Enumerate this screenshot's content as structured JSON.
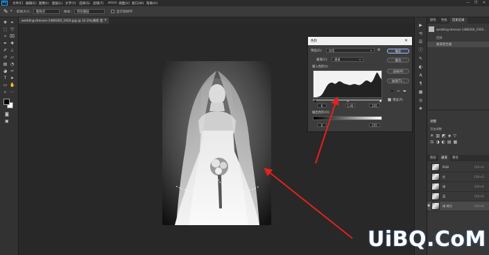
{
  "menubar": {
    "app_logo": "Ps",
    "items": [
      "文件(F)",
      "编辑(E)",
      "图像(I)",
      "图层(L)",
      "文字(Y)",
      "选择(S)",
      "滤镜(T)",
      "3D(D)",
      "视图(V)",
      "窗口(W)",
      "帮助(H)"
    ],
    "window_controls": [
      "—",
      "❐",
      "✕"
    ]
  },
  "options_bar": {
    "sample_size_label": "取样大小:",
    "sample_size_value": "取样点",
    "sample_label": "样本:",
    "sample_value": "所有图层",
    "show_ring_label": "显示取样环"
  },
  "document": {
    "tab_title": "wedding-dresses-1486260_1920.jpg @ 33.3%(通道 混合器 1, RGB/8) *",
    "close": "×"
  },
  "levels_dialog": {
    "title": "色阶",
    "close": "✕",
    "preset_label": "预设(E):",
    "preset_value": "自定",
    "channel_label": "通道(C):",
    "channel_value": "通道",
    "input_levels_label": "输入色阶(I):",
    "output_levels_label": "输出色阶(O):",
    "input_values": [
      "6",
      "1.00",
      "255"
    ],
    "output_values": [
      "0",
      "255"
    ],
    "buttons": [
      "确定",
      "复位",
      "自动(A)",
      "选项(T)..."
    ],
    "preview_label": "预览(P)",
    "preview_checked": true
  },
  "right_panel": {
    "top_tabs": [
      "颜色",
      "色板",
      "历史记录"
    ],
    "history_doc": "wedding-dresses-1486260_1920...",
    "history_items": [
      "打开",
      "通道混合器"
    ],
    "adjust_title": "调整",
    "adjust_subtitle": "添加调整",
    "bottom_tabs": [
      "图层",
      "通道",
      "路径"
    ],
    "channels": [
      {
        "name": "RGB",
        "shortcut": "Ctrl+2"
      },
      {
        "name": "红",
        "shortcut": "Ctrl+3"
      },
      {
        "name": "绿",
        "shortcut": "Ctrl+4"
      },
      {
        "name": "蓝",
        "shortcut": "Ctrl+5"
      },
      {
        "name": "绿 拷贝",
        "shortcut": "Ctrl+6"
      }
    ]
  },
  "watermark": "UiBQ.CoM",
  "colors": {
    "annotation_arrow": "#e62020",
    "panel_bg": "#383838",
    "dialog_bg": "#3c3c3c"
  },
  "histogram": [
    0,
    0,
    0,
    1,
    2,
    4,
    8,
    14,
    20,
    26,
    30,
    32,
    33,
    32,
    30,
    31,
    34,
    36,
    35,
    33,
    31,
    30,
    29,
    28,
    27,
    28,
    29,
    30,
    29,
    28,
    27,
    28,
    30,
    33,
    36,
    38,
    37,
    35,
    33,
    36,
    42,
    50,
    56,
    52,
    45,
    40
  ]
}
